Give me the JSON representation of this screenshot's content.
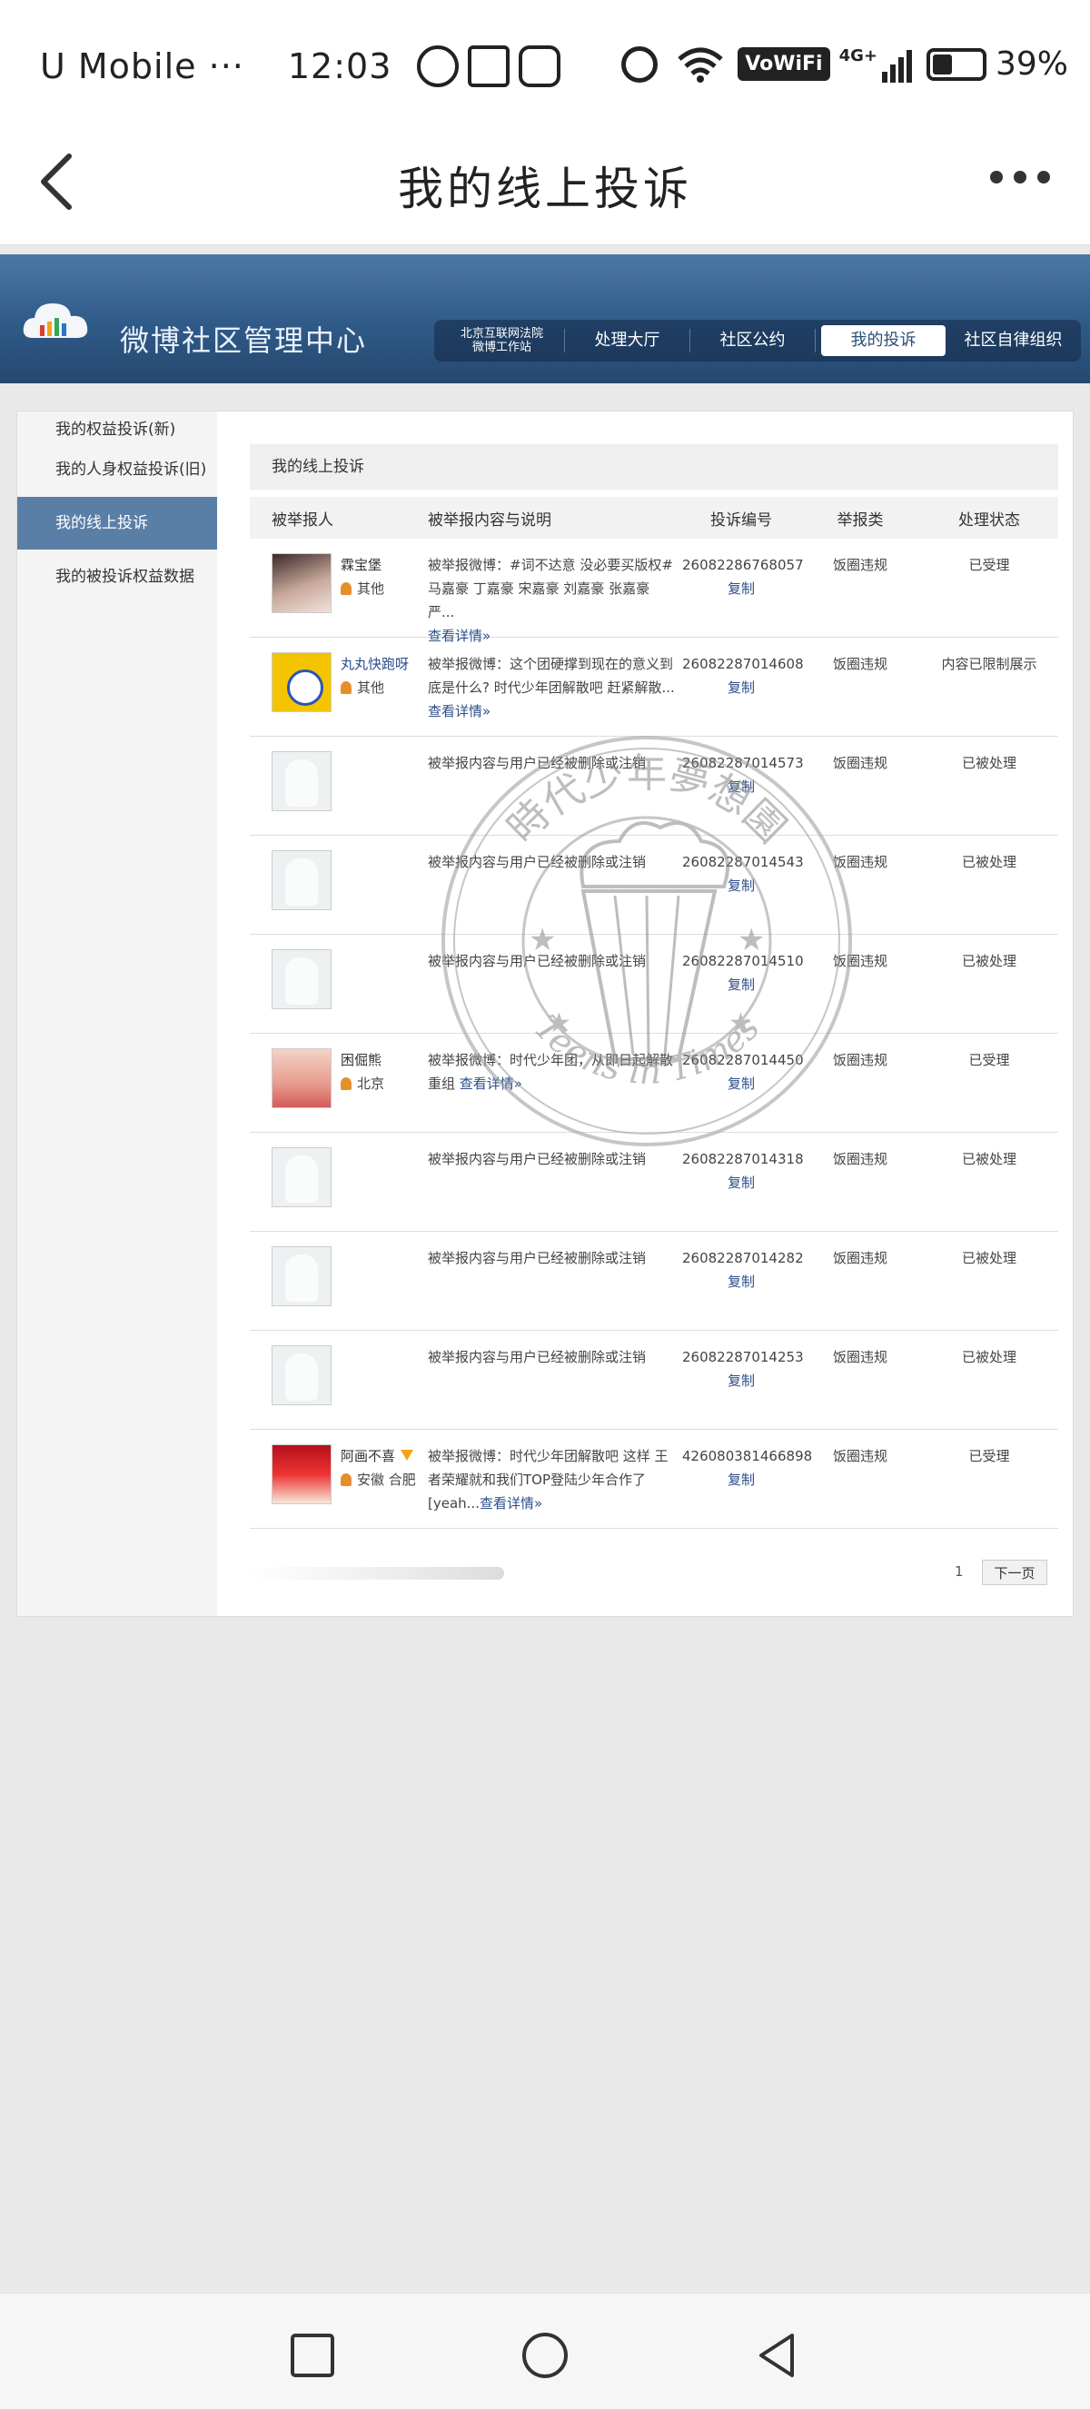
{
  "status_bar": {
    "carrier": "U Mobile ···",
    "time": "12:03",
    "network_badge": "VoWiFi",
    "network_type": "4G+",
    "battery_percent_label": "39%",
    "battery_level": 0.39,
    "apps": [
      "whatsapp-icon",
      "shopee-icon",
      "instagram-icon"
    ]
  },
  "app_bar": {
    "title": "我的线上投诉"
  },
  "weibo_header": {
    "title": "微博社区管理中心",
    "nav": [
      {
        "label": "北京互联网法院 微博工作站"
      },
      {
        "label": "处理大厅"
      },
      {
        "label": "社区公约"
      },
      {
        "label": "我的投诉"
      },
      {
        "label": "社区自律组织"
      }
    ],
    "court_line1": "北京互联网法院",
    "court_line2": "微博工作站"
  },
  "sidebar": {
    "items": [
      {
        "label": "我的权益投诉(新)"
      },
      {
        "label": "我的人身权益投诉(旧)"
      },
      {
        "label": "我的线上投诉"
      },
      {
        "label": "我的被投诉权益数据"
      }
    ]
  },
  "main": {
    "title": "我的线上投诉",
    "columns": [
      "被举报人",
      "被举报内容与说明",
      "投诉编号",
      "举报类",
      "处理状态"
    ],
    "detail_text": "查看详情»",
    "copy_text": "复制",
    "rows": [
      {
        "name": "霖宝堡",
        "location": "其他",
        "content": "被举报微博：#词不达意 没必要买版权# 马嘉豪 丁嘉豪 宋嘉豪 刘嘉豪 张嘉豪 严...",
        "id": "26082286768057",
        "type": "饭圈违规",
        "status": "已受理"
      },
      {
        "name": "丸丸快跑呀",
        "location": "其他",
        "content": "被举报微博：这个团硬撑到现在的意义到底是什么? 时代少年团解散吧 赶紧解散...",
        "id": "26082287014608",
        "type": "饭圈违规",
        "status": "内容已限制展示"
      },
      {
        "name": "",
        "location": "",
        "content": "被举报内容与用户已经被删除或注销",
        "id": "26082287014573",
        "type": "饭圈违规",
        "status": "已被处理"
      },
      {
        "name": "",
        "location": "",
        "content": "被举报内容与用户已经被删除或注销",
        "id": "26082287014543",
        "type": "饭圈违规",
        "status": "已被处理"
      },
      {
        "name": "",
        "location": "",
        "content": "被举报内容与用户已经被删除或注销",
        "id": "26082287014510",
        "type": "饭圈违规",
        "status": "已被处理"
      },
      {
        "name": "困倔熊",
        "location": "北京",
        "content": "被举报微博：时代少年团，从即日起解散重组",
        "id": "26082287014450",
        "type": "饭圈违规",
        "status": "已受理"
      },
      {
        "name": "",
        "location": "",
        "content": "被举报内容与用户已经被删除或注销",
        "id": "26082287014318",
        "type": "饭圈违规",
        "status": "已被处理"
      },
      {
        "name": "",
        "location": "",
        "content": "被举报内容与用户已经被删除或注销",
        "id": "26082287014282",
        "type": "饭圈违规",
        "status": "已被处理"
      },
      {
        "name": "",
        "location": "",
        "content": "被举报内容与用户已经被删除或注销",
        "id": "26082287014253",
        "type": "饭圈违规",
        "status": "已被处理"
      },
      {
        "name": "阿画不喜",
        "location": "安徽 合肥",
        "content": "被举报微博：时代少年团解散吧 这样 王者荣耀就和我们TOP登陆少年合作了[yeah...",
        "id": "426080381466898",
        "type": "饭圈违规",
        "status": "已受理"
      }
    ],
    "pager": {
      "page": "1",
      "next": "下一页"
    }
  },
  "stamp": {
    "top_text": "時代少年夢想園",
    "bottom_text": "Teens in Times"
  }
}
